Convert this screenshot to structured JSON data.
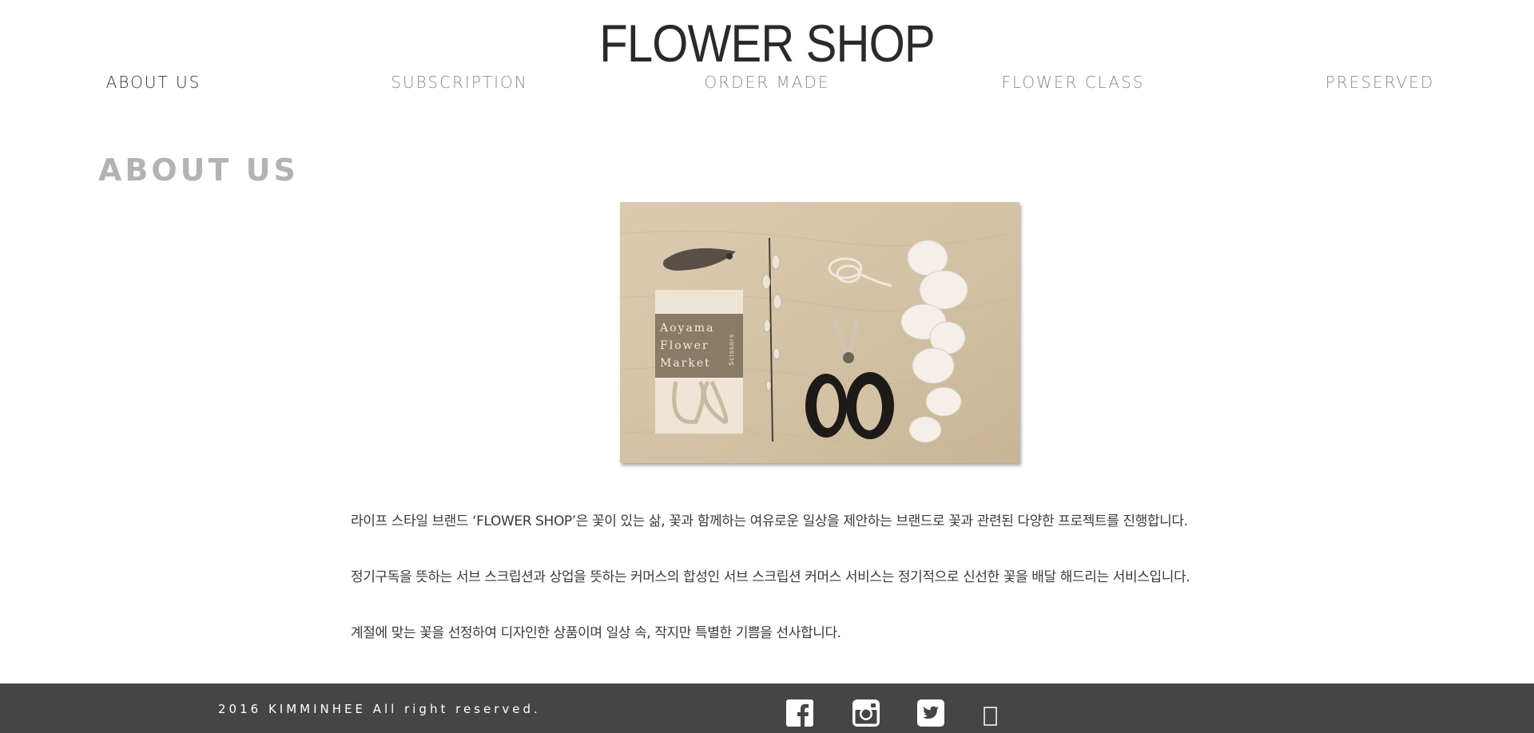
{
  "header": {
    "logo_text": "FLOWER SHOP",
    "nav": [
      {
        "label": "ABOUT US",
        "active": true
      },
      {
        "label": "SUBSCRIPTION",
        "active": false
      },
      {
        "label": "ORDER MADE",
        "active": false
      },
      {
        "label": "FLOWER CLASS",
        "active": false
      },
      {
        "label": "PRESERVED",
        "active": false
      }
    ]
  },
  "main": {
    "section_title": "ABOUT US",
    "photo": {
      "box_text": [
        "Aoyama",
        "Flower",
        "Market"
      ],
      "box_side_text": "Scissors"
    },
    "paragraphs": [
      "라이프 스타일 브랜드 ‘FLOWER SHOP’은 꽃이 있는 삶, 꽃과 함께하는 여유로운 일상을 제안하는 브랜드로 꽃과 관련된 다양한 프로젝트를 진행합니다.",
      "정기구독을 뜻하는 서브 스크립션과 상업을 뜻하는 커머스의 합성인 서브 스크립션 커머스 서비스는 정기적으로 신선한 꽃을 배달 해드리는 서비스입니다.",
      "계절에 맞는 꽃을 선정하여 디자인한 상품이며 일상 속, 작지만 특별한 기쁨을 선사합니다."
    ]
  },
  "footer": {
    "copyright": "2016 KIMMINHEE All right reserved.",
    "social_icons": [
      "facebook-icon",
      "instagram-icon",
      "twitter-icon",
      "missing-glyph-icon"
    ]
  },
  "colors": {
    "footer_bg": "#454545",
    "heading_gray": "#b3b3b3",
    "nav_gray": "#8a8a8a",
    "photo_sepia": "#d6c5ab"
  }
}
